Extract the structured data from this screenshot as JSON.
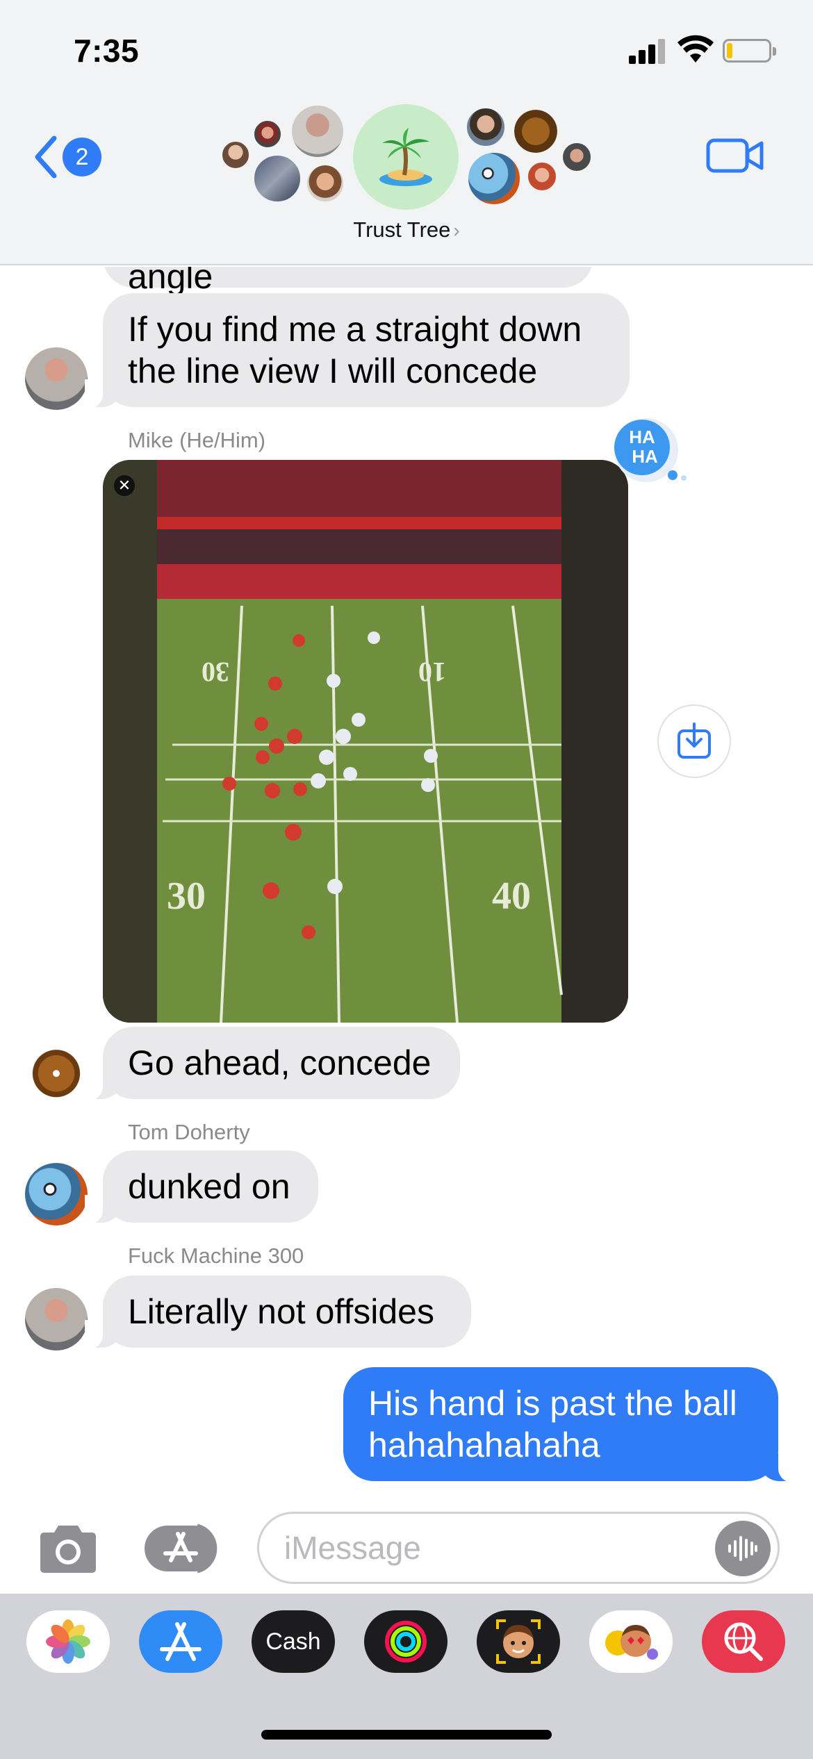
{
  "status_bar": {
    "time": "7:35"
  },
  "header": {
    "back_badge": "2",
    "group_name": "Trust Tree",
    "chevron": "›",
    "group_emoji": "🏝️"
  },
  "messages": {
    "partial_top": "That is a non conclusive angle",
    "msg1_line1": "If you find me a straight down",
    "msg1_line2": "the line view I will concede",
    "sender_mike": "Mike (He/Him)",
    "haha_line1": "HA",
    "haha_line2": "HA",
    "close_glyph": "✕",
    "field_numbers": {
      "left_top": "30",
      "right_top": "10",
      "left_bottom": "30",
      "right_bottom": "40"
    },
    "msg2": "Go ahead, concede",
    "sender_tom": "Tom Doherty",
    "msg3": "dunked on",
    "sender_fm": "Fuck Machine 300",
    "msg4": "Literally not offsides",
    "me_line1": "His hand is past the ball",
    "me_line2": "hahahahahaha"
  },
  "input": {
    "placeholder": "iMessage"
  },
  "drawer": {
    "cash_label": "Cash",
    "cash_glyph": ""
  },
  "colors": {
    "accent_blue": "#2f7cf6",
    "bubble_gray": "#e9e9eb",
    "drawer_bg": "#d1d3d9",
    "haha_blue": "#3d98f0"
  }
}
